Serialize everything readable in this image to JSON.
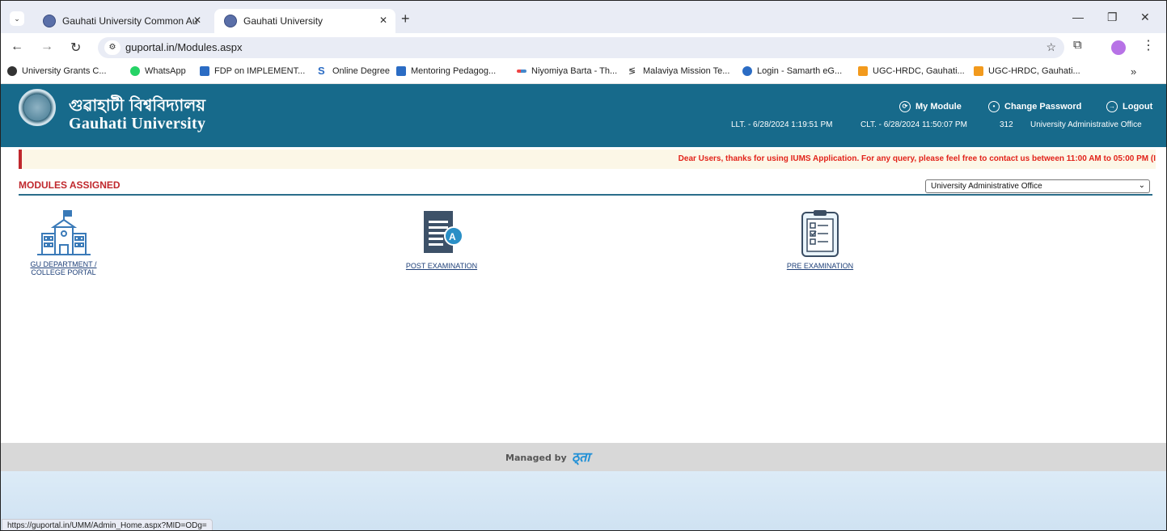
{
  "browser": {
    "tabs": [
      {
        "title": "Gauhati University Common Au"
      },
      {
        "title": "Gauhati University"
      }
    ],
    "url": "guportal.in/Modules.aspx",
    "bookmarks": [
      "University Grants C...",
      "WhatsApp",
      "FDP on IMPLEMENT...",
      "Online Degree",
      "Mentoring Pedagog...",
      "Niyomiya Barta - Th...",
      "Malaviya Mission Te...",
      "Login - Samarth eG...",
      "UGC-HRDC, Gauhati...",
      "UGC-HRDC, Gauhati..."
    ],
    "status_url": "https://guportal.in/UMM/Admin_Home.aspx?MID=ODg="
  },
  "header": {
    "title_bn": "গুৱাহাটী বিশ্ববিদ্যালয়",
    "title_en": "Gauhati University",
    "my_module": "My Module",
    "change_password": "Change Password",
    "logout": "Logout",
    "llt": "LLT. - 6/28/2024 1:19:51 PM",
    "clt": "CLT. - 6/28/2024 11:50:07 PM",
    "user_id": "312",
    "office": "University Administrative Office"
  },
  "notice": "Dear Users, thanks for using IUMS Application. For any query, please feel free to contact us between 11:00 AM to 05:00 PM (I",
  "modules": {
    "title": "MODULES ASSIGNED",
    "selected_office": "University Administrative Office",
    "items": [
      {
        "label_line1": "GU DEPARTMENT /",
        "label_line2": "COLLEGE PORTAL",
        "icon": "building-icon"
      },
      {
        "label_line1": "POST EXAMINATION",
        "label_line2": "",
        "icon": "document-grade-icon"
      },
      {
        "label_line1": "PRE EXAMINATION",
        "label_line2": "",
        "icon": "clipboard-checklist-icon"
      }
    ]
  },
  "footer": {
    "managed_by": "Managed by",
    "vendor_logo_text": "ठ्ता"
  }
}
